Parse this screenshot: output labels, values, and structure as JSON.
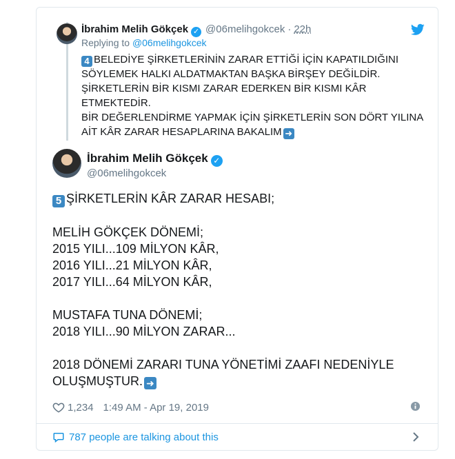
{
  "reply_tweet": {
    "name": "İbrahim Melih Gökçek",
    "handle": "@06melihgokcek",
    "time": "22h",
    "replying_prefix": "Replying to",
    "replying_to": "@06melihgokcek",
    "keycap": "4",
    "text": "BELEDİYE ŞİRKETLERİNİN ZARAR ETTİĞİ İÇİN KAPATILDIĞINI SÖYLEMEK HALKI ALDATMAKTAN BAŞKA BİRŞEY DEĞİLDİR.\nŞİRKETLERİN BİR KISMI ZARAR EDERKEN BİR KISMI KÂR ETMEKTEDİR.\nBİR DEĞERLENDİRME YAPMAK İÇİN ŞİRKETLERİN SON DÖRT YILINA AİT KÂR ZARAR HESAPLARINA BAKALIM"
  },
  "main_tweet": {
    "name": "İbrahim Melih Gökçek",
    "handle": "@06melihgokcek",
    "keycap": "5",
    "text": "ŞİRKETLERİN KÂR ZARAR HESABI;\n\nMELİH GÖKÇEK DÖNEMİ;\n2015 YILI...109 MİLYON KÂR,\n2016 YILI...21    MİLYON KÂR,\n2017 YILI...64    MİLYON KÂR,\n\nMUSTAFA TUNA DÖNEMİ;\n2018 YILI...90 MİLYON ZARAR...\n\n2018 DÖNEMİ ZARARI TUNA YÖNETİMİ ZAAFI NEDENİYLE OLUŞMUŞTUR.",
    "likes": "1,234",
    "timestamp": "1:49 AM - Apr 19, 2019"
  },
  "footer": {
    "talking": "787 people are talking about this"
  },
  "colors": {
    "accent": "#1da1f2",
    "link": "#1b95e0",
    "muted": "#657786",
    "keycap": "#3b88c3"
  }
}
